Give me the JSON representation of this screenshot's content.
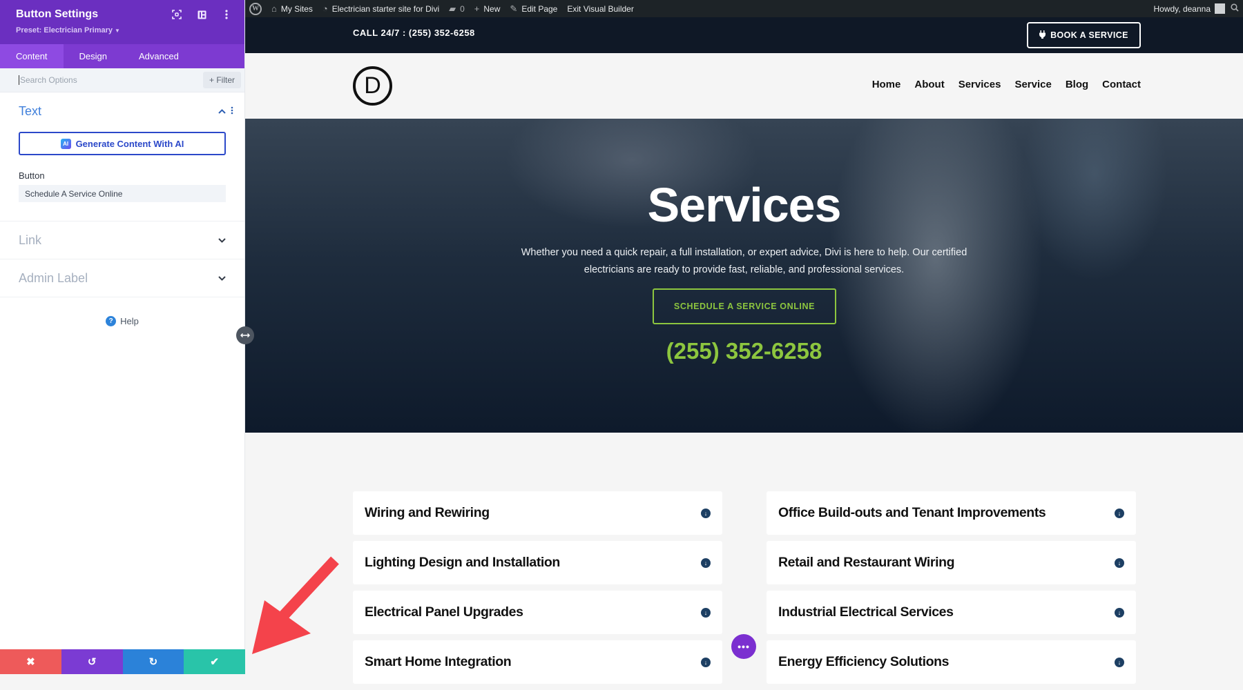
{
  "panel": {
    "title": "Button Settings",
    "preset": "Preset: Electrician Primary",
    "header_icons": [
      "focus-icon",
      "split-view-icon",
      "more-options-icon"
    ],
    "tabs": [
      {
        "label": "Content",
        "active": true
      },
      {
        "label": "Design",
        "active": false
      },
      {
        "label": "Advanced",
        "active": false
      }
    ],
    "search": {
      "placeholder": "Search Options",
      "value": ""
    },
    "filter_label": "+ Filter",
    "sections": [
      {
        "title": "Text",
        "open": true
      },
      {
        "title": "Link",
        "open": false
      },
      {
        "title": "Admin Label",
        "open": false
      }
    ],
    "ai_button": "Generate Content With AI",
    "ai_badge": "AI",
    "button_field": {
      "label": "Button",
      "value": "Schedule A Service Online"
    },
    "help": "Help",
    "footer": {
      "cancel": "✖",
      "undo": "↺",
      "redo": "↻",
      "save": "✔"
    },
    "colors": {
      "header": "#6b2fc0",
      "cancel": "#ee5a5a",
      "undo": "#7b3bd3",
      "redo": "#2b82d9",
      "save": "#29c4a9"
    }
  },
  "adminbar": {
    "items": [
      {
        "icon": "wordpress-icon",
        "label": ""
      },
      {
        "icon": "my-sites-icon",
        "label": "My Sites"
      },
      {
        "icon": "dashboard-icon",
        "label": "Electrician starter site for Divi"
      },
      {
        "icon": "comment-icon",
        "label": "0"
      },
      {
        "icon": "plus-icon",
        "label": "New"
      },
      {
        "icon": "pencil-icon",
        "label": "Edit Page"
      },
      {
        "icon": "",
        "label": "Exit Visual Builder"
      }
    ],
    "greeting": "Howdy, deanna"
  },
  "site": {
    "topbar": {
      "call": "CALL 24/7 : (255) 352-6258",
      "book_button": "BOOK A SERVICE"
    },
    "logo": "D",
    "nav": [
      "Home",
      "About",
      "Services",
      "Service",
      "Blog",
      "Contact"
    ],
    "hero": {
      "title": "Services",
      "text": "Whether you need a quick repair, a full installation, or expert advice, Divi is here to help. Our certified electricians are ready to provide fast, reliable, and professional services.",
      "cta": "SCHEDULE A SERVICE ONLINE",
      "phone": "(255) 352-6258"
    },
    "services_left": [
      "Wiring and Rewiring",
      "Lighting Design and Installation",
      "Electrical Panel Upgrades",
      "Smart Home Integration"
    ],
    "services_right": [
      "Office Build-outs and Tenant Improvements",
      "Retail and Restaurant Wiring",
      "Industrial Electrical Services",
      "Energy Efficiency Solutions"
    ],
    "accent": "#8dc63f"
  },
  "fab_label": "•••"
}
